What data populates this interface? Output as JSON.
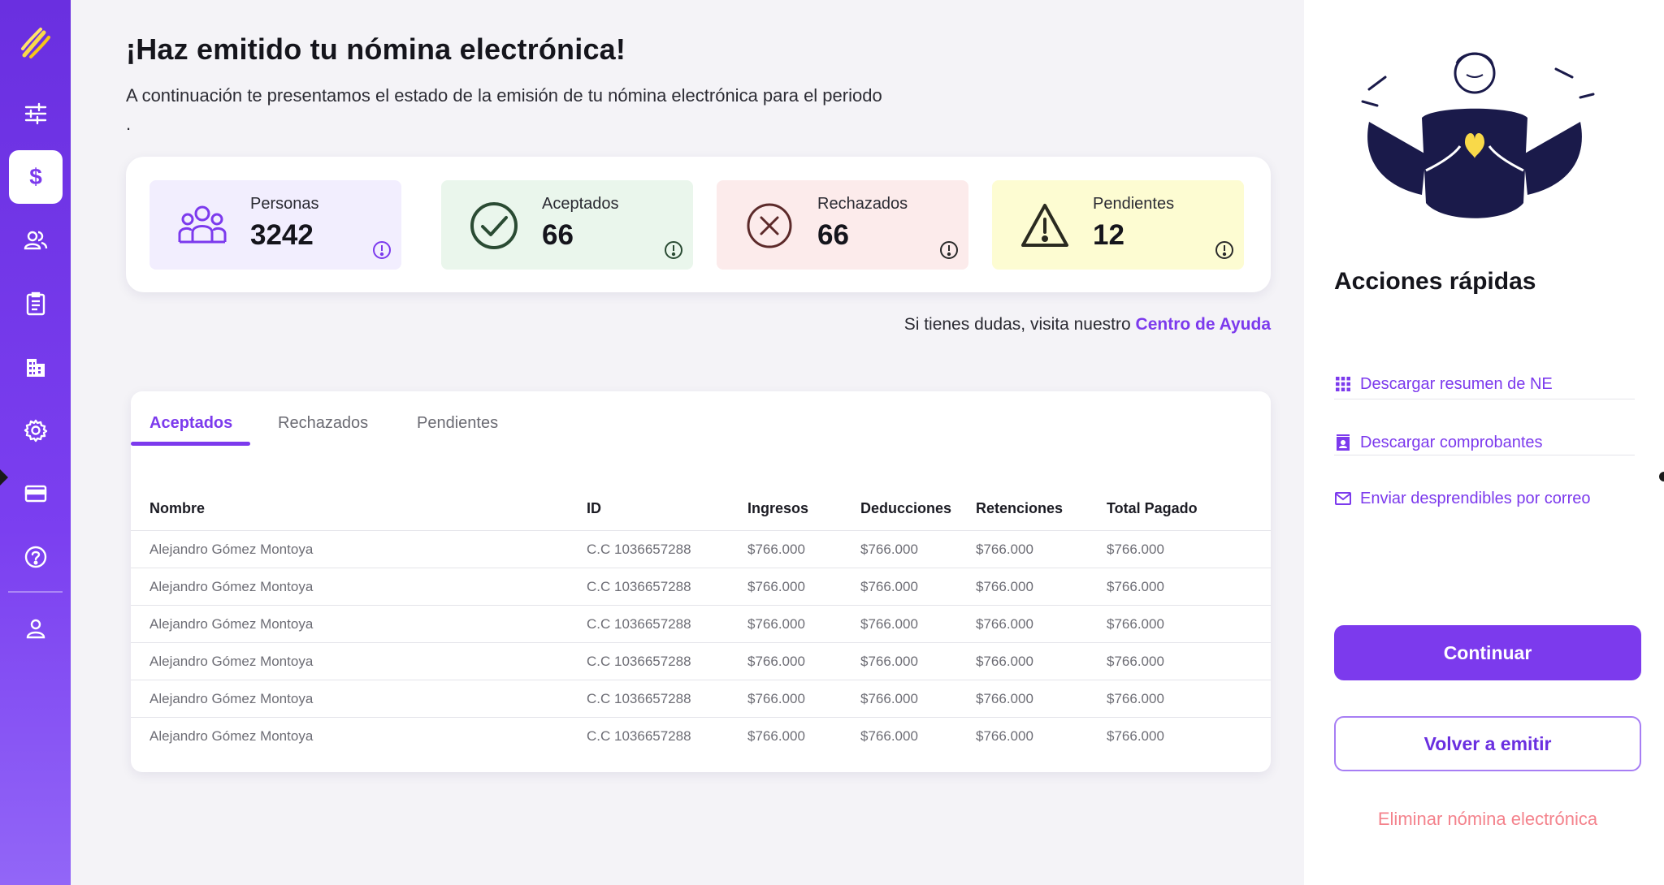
{
  "header": {
    "title": "¡Haz emitido tu nómina electrónica!",
    "subtitle": "A continuación te presentamos el estado de la emisión de tu nómina electrónica para el periodo ."
  },
  "stats": [
    {
      "label": "Personas",
      "value": "3242",
      "bg": "#f2eefe",
      "color": "#7c3aed"
    },
    {
      "label": "Aceptados",
      "value": "66",
      "bg": "#eaf6ec",
      "color": "#2a4b33"
    },
    {
      "label": "Rechazados",
      "value": "66",
      "bg": "#fcebeb",
      "color": "#5c2a2a"
    },
    {
      "label": "Pendientes",
      "value": "12",
      "bg": "#fdfcd2",
      "color": "#2a2a20"
    }
  ],
  "help": {
    "text": "Si tienes dudas, visita nuestro",
    "link": "Centro de Ayuda"
  },
  "tabs": [
    "Aceptados",
    "Rechazados",
    "Pendientes"
  ],
  "table": {
    "columns": [
      "Nombre",
      "ID",
      "Ingresos",
      "Deducciones",
      "Retenciones",
      "Total Pagado"
    ],
    "rows": [
      [
        "Alejandro Gómez Montoya",
        "C.C 1036657288",
        "$766.000",
        "$766.000",
        "$766.000",
        "$766.000"
      ],
      [
        "Alejandro Gómez Montoya",
        "C.C 1036657288",
        "$766.000",
        "$766.000",
        "$766.000",
        "$766.000"
      ],
      [
        "Alejandro Gómez Montoya",
        "C.C 1036657288",
        "$766.000",
        "$766.000",
        "$766.000",
        "$766.000"
      ],
      [
        "Alejandro Gómez Montoya",
        "C.C 1036657288",
        "$766.000",
        "$766.000",
        "$766.000",
        "$766.000"
      ],
      [
        "Alejandro Gómez Montoya",
        "C.C 1036657288",
        "$766.000",
        "$766.000",
        "$766.000",
        "$766.000"
      ],
      [
        "Alejandro Gómez Montoya",
        "C.C 1036657288",
        "$766.000",
        "$766.000",
        "$766.000",
        "$766.000"
      ]
    ]
  },
  "quick_actions": {
    "title": "Acciones rápidas",
    "items": [
      {
        "label": "Descargar resumen de NE",
        "icon": "grid-icon"
      },
      {
        "label": "Descargar comprobantes",
        "icon": "contact-card-icon"
      },
      {
        "label": "Enviar desprendibles por correo",
        "icon": "mail-icon"
      }
    ],
    "continue_label": "Continuar",
    "reissue_label": "Volver a emitir",
    "delete_label": "Eliminar nómina electrónica"
  },
  "sidebar": {
    "items": [
      "sliders-icon",
      "dollar-icon",
      "users-icon",
      "clipboard-icon",
      "building-icon",
      "gear-icon",
      "credit-card-icon",
      "help-icon",
      "user-icon"
    ],
    "active": "dollar-icon"
  },
  "colors": {
    "brand": "#7c3aed",
    "sidebar": "#6a2fe0",
    "danger_text": "#f4828c",
    "logo_yellow": "#f9d949"
  }
}
